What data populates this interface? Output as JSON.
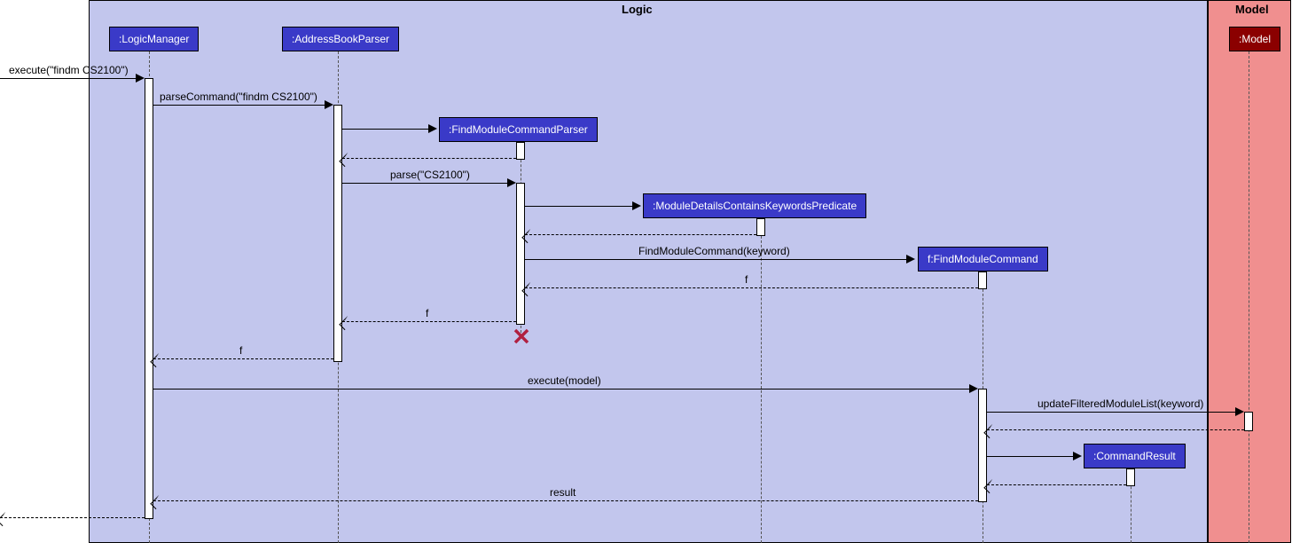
{
  "frames": {
    "logic": "Logic",
    "model": "Model"
  },
  "participants": {
    "logicManager": ":LogicManager",
    "addressBookParser": ":AddressBookParser",
    "findModuleCommandParser": ":FindModuleCommandParser",
    "moduleDetailsPredicate": ":ModuleDetailsContainsKeywordsPredicate",
    "findModuleCommand": "f:FindModuleCommand",
    "commandResult": ":CommandResult",
    "model": ":Model"
  },
  "messages": {
    "execute": "execute(\"findm CS2100\")",
    "parseCommand": "parseCommand(\"findm CS2100\")",
    "parse": "parse(\"CS2100\")",
    "findModuleCommandCtor": "FindModuleCommand(keyword)",
    "return_f1": "f",
    "return_f2": "f",
    "return_f3": "f",
    "executeModel": "execute(model)",
    "updateFilteredModuleList": "updateFilteredModuleList(keyword)",
    "result": "result"
  },
  "chart_data": {
    "type": "sequence_diagram",
    "frames": [
      {
        "name": "Logic",
        "participants": [
          "LogicManager",
          "AddressBookParser",
          "FindModuleCommandParser",
          "ModuleDetailsContainsKeywordsPredicate",
          "FindModuleCommand",
          "CommandResult"
        ]
      },
      {
        "name": "Model",
        "participants": [
          "Model"
        ]
      }
    ],
    "participants": [
      {
        "id": "LogicManager",
        "label": ":LogicManager"
      },
      {
        "id": "AddressBookParser",
        "label": ":AddressBookParser"
      },
      {
        "id": "FindModuleCommandParser",
        "label": ":FindModuleCommandParser",
        "created": true,
        "destroyed": true
      },
      {
        "id": "ModuleDetailsContainsKeywordsPredicate",
        "label": ":ModuleDetailsContainsKeywordsPredicate",
        "created": true
      },
      {
        "id": "FindModuleCommand",
        "label": "f:FindModuleCommand",
        "created": true
      },
      {
        "id": "CommandResult",
        "label": ":CommandResult",
        "created": true
      },
      {
        "id": "Model",
        "label": ":Model"
      }
    ],
    "messages": [
      {
        "from": "external",
        "to": "LogicManager",
        "label": "execute(\"findm CS2100\")",
        "type": "sync"
      },
      {
        "from": "LogicManager",
        "to": "AddressBookParser",
        "label": "parseCommand(\"findm CS2100\")",
        "type": "sync"
      },
      {
        "from": "AddressBookParser",
        "to": "FindModuleCommandParser",
        "label": "",
        "type": "create"
      },
      {
        "from": "FindModuleCommandParser",
        "to": "AddressBookParser",
        "label": "",
        "type": "return"
      },
      {
        "from": "AddressBookParser",
        "to": "FindModuleCommandParser",
        "label": "parse(\"CS2100\")",
        "type": "sync"
      },
      {
        "from": "FindModuleCommandParser",
        "to": "ModuleDetailsContainsKeywordsPredicate",
        "label": "",
        "type": "create"
      },
      {
        "from": "ModuleDetailsContainsKeywordsPredicate",
        "to": "FindModuleCommandParser",
        "label": "",
        "type": "return"
      },
      {
        "from": "FindModuleCommandParser",
        "to": "FindModuleCommand",
        "label": "FindModuleCommand(keyword)",
        "type": "create"
      },
      {
        "from": "FindModuleCommand",
        "to": "FindModuleCommandParser",
        "label": "f",
        "type": "return"
      },
      {
        "from": "FindModuleCommandParser",
        "to": "AddressBookParser",
        "label": "f",
        "type": "return"
      },
      {
        "from": "FindModuleCommandParser",
        "to": null,
        "label": "",
        "type": "destroy"
      },
      {
        "from": "AddressBookParser",
        "to": "LogicManager",
        "label": "f",
        "type": "return"
      },
      {
        "from": "LogicManager",
        "to": "FindModuleCommand",
        "label": "execute(model)",
        "type": "sync"
      },
      {
        "from": "FindModuleCommand",
        "to": "Model",
        "label": "updateFilteredModuleList(keyword)",
        "type": "sync"
      },
      {
        "from": "Model",
        "to": "FindModuleCommand",
        "label": "",
        "type": "return"
      },
      {
        "from": "FindModuleCommand",
        "to": "CommandResult",
        "label": "",
        "type": "create"
      },
      {
        "from": "CommandResult",
        "to": "FindModuleCommand",
        "label": "",
        "type": "return"
      },
      {
        "from": "FindModuleCommand",
        "to": "LogicManager",
        "label": "result",
        "type": "return"
      },
      {
        "from": "LogicManager",
        "to": "external",
        "label": "",
        "type": "return"
      }
    ]
  }
}
